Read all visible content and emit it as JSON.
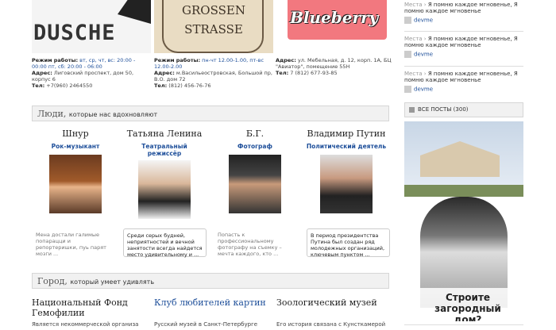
{
  "places": [
    {
      "logo": "DUSCHE",
      "hours_label": "Режим работы:",
      "hours": "вт, ср, чт, вс: 20:00 - 00:00 пт, сб: 20:00 - 06:00",
      "address_label": "Адрес:",
      "address": "Лиговский проспект, дом 50, корпус 6",
      "phone_label": "Тел:",
      "phone": "+7(960) 2464550"
    },
    {
      "logo_line1": "GROSSEN",
      "logo_line2": "STRASSE",
      "hours_label": "Режим работы:",
      "hours": "пн-чт 12.00-1.00, пт-вс 12.00-2.00",
      "address_label": "Адрес:",
      "address": "м.Васильеостровская, Большой пр, В.О. дом 72",
      "phone_label": "Тел:",
      "phone": "(812) 456-76-76"
    },
    {
      "logo": "Blueberry",
      "address_label": "Адрес:",
      "address": "ул. Мебельная, д. 12, корп. 1А, БЦ \"Авиатор\", помещение 55Н",
      "phone_label": "Тел:",
      "phone": "7 (812) 677-93-85"
    }
  ],
  "people_section": {
    "title": "Люди,",
    "subtitle": "которые нас вдохновляют"
  },
  "people": [
    {
      "name": "Шнур",
      "role": "Рок-музыкант",
      "quote": "Мена достали галимые попарацци и репортеришки, пуь парят мозги ..."
    },
    {
      "name": "Татьяна Ленина",
      "role": "Театральный режиссёр",
      "quote": "Среди серых будней, неприятностей и вечной занятости всегда найдется место удивительному и ..."
    },
    {
      "name": "Б.Г.",
      "role": "Фотограф",
      "quote": "Попасть к профессиональному фотографу на съемку – мечта каждого, кто ..."
    },
    {
      "name": "Владимир Путин",
      "role": "Политический деятель",
      "quote": "В период президентства Путина был создан ряд молодежных организаций, ключевым пунктом ..."
    }
  ],
  "city_section": {
    "title": "Город,",
    "subtitle": "который умеет удивлять"
  },
  "city": [
    {
      "title": "Национальный Фонд Гемофилии",
      "desc": "Является некоммерческой организа"
    },
    {
      "title": "Клуб любителей картин",
      "desc": "Русский музей в Санкт-Петербурге"
    },
    {
      "title": "Зоологический музей",
      "desc": "Его история связана с Кунсткамерой"
    }
  ],
  "sidebar": {
    "posts": [
      {
        "category": "Места",
        "text": "Я помню каждое мгновенье, Я помню каждое мгновенье",
        "user": "devme"
      },
      {
        "category": "Места",
        "text": "Я помню каждое мгновенье, Я помню каждое мгновенье",
        "user": "devme"
      },
      {
        "category": "Места",
        "text": "Я помню каждое мгновенье, Я помню каждое мгновенье",
        "user": "devme"
      }
    ],
    "all_posts": "ВСЕ ПОСТЫ (300)",
    "ad_text": "Строите загородный дом?"
  }
}
